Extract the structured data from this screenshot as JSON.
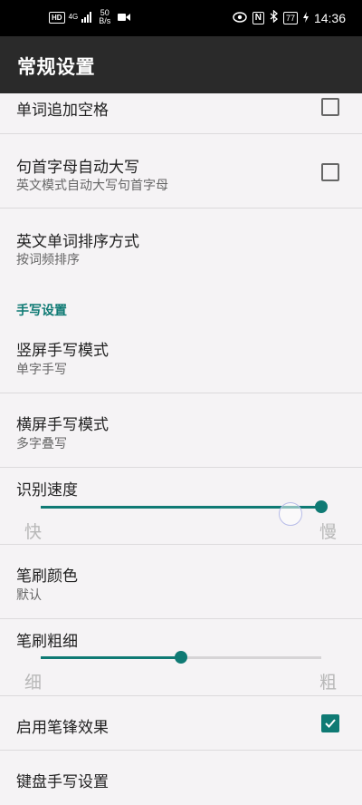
{
  "status_bar": {
    "hd": "HD",
    "network": "4G",
    "speed_value": "50",
    "speed_unit": "B/s",
    "nfc": "N",
    "battery": "77",
    "time": "14:36"
  },
  "app_bar": {
    "title": "常规设置"
  },
  "items": {
    "append_space": {
      "title": "单词追加空格",
      "checked": false
    },
    "auto_capitalize": {
      "title": "句首字母自动大写",
      "subtitle": "英文模式自动大写句首字母",
      "checked": false
    },
    "english_sort": {
      "title": "英文单词排序方式",
      "subtitle": "按词频排序"
    }
  },
  "handwriting_section": {
    "header": "手写设置",
    "portrait_mode": {
      "title": "竖屏手写模式",
      "subtitle": "单字手写"
    },
    "landscape_mode": {
      "title": "横屏手写模式",
      "subtitle": "多字叠写"
    },
    "recognition_speed": {
      "title": "识别速度",
      "min_label": "快",
      "max_label": "慢",
      "value_percent": 100
    },
    "stroke_color": {
      "title": "笔刷颜色",
      "subtitle": "默认"
    },
    "stroke_width": {
      "title": "笔刷粗细",
      "min_label": "细",
      "max_label": "粗",
      "value_percent": 50
    },
    "brush_tip": {
      "title": "启用笔锋效果",
      "checked": true
    },
    "keyboard_handwriting": {
      "title": "键盘手写设置"
    }
  },
  "colors": {
    "accent": "#0f7a74",
    "appbar": "#2a2a2a",
    "background": "#f5f3f5"
  }
}
